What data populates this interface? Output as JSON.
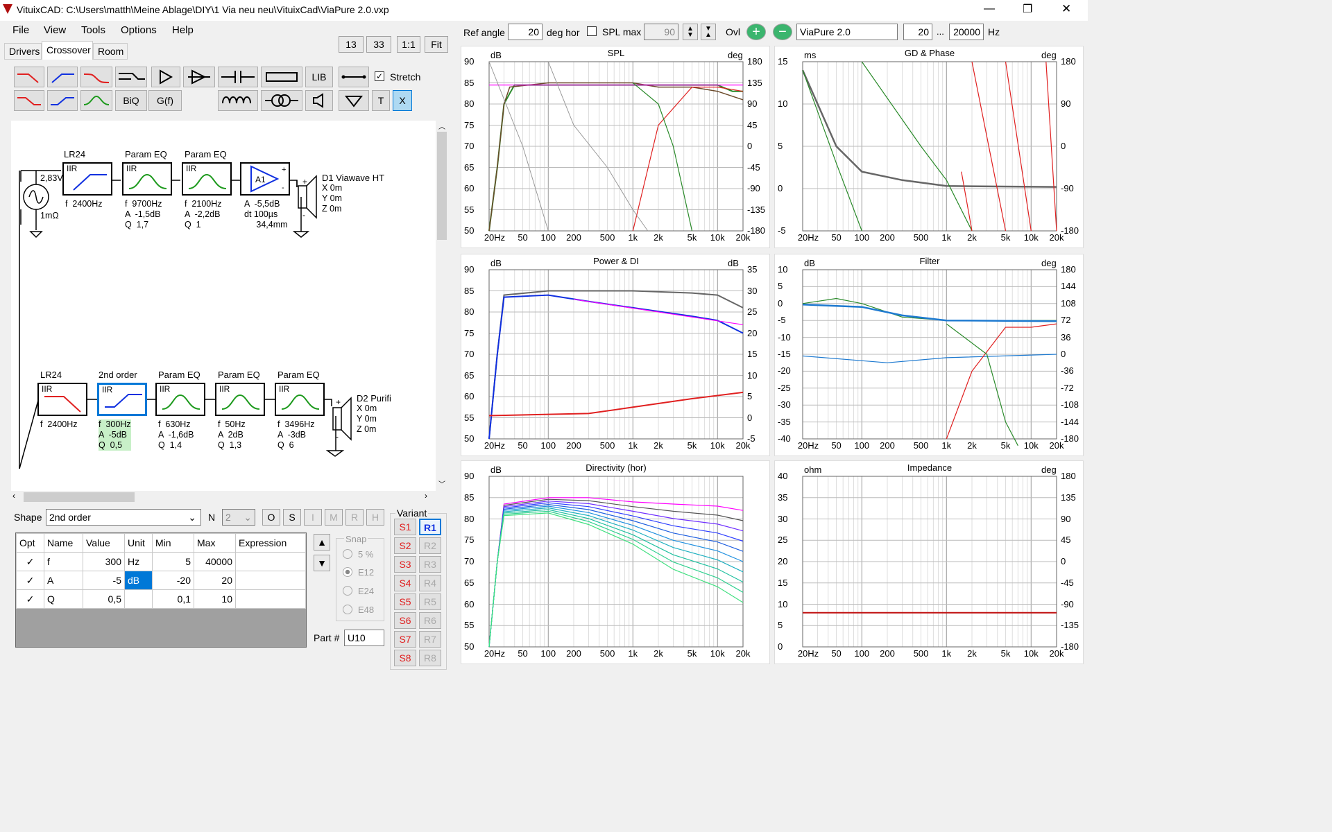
{
  "window": {
    "title": "VituixCAD: C:\\Users\\matth\\Meine Ablage\\DIY\\1 Via neu neu\\VituixCad\\ViaPure 2.0.vxp",
    "min": "—",
    "max": "❐",
    "close": "✕"
  },
  "menu": [
    "File",
    "View",
    "Tools",
    "Options",
    "Help"
  ],
  "tabs": [
    "Drivers",
    "Crossover",
    "Room"
  ],
  "zoom": [
    "13",
    "33",
    "1:1",
    "Fit"
  ],
  "toolbar": {
    "lib": "LIB",
    "stretch": "Stretch",
    "biq": "BiQ",
    "gf": "G(f)",
    "t": "T",
    "x": "X"
  },
  "top": {
    "ref_angle_label": "Ref angle",
    "ref_angle": "20",
    "deg_hor": "deg hor",
    "spl_max_label": "SPL max",
    "spl_max": "90",
    "ovl": "Ovl",
    "project": "ViaPure 2.0",
    "f_low": "20",
    "dots": "...",
    "f_high": "20000",
    "hz": "Hz"
  },
  "branch1": {
    "source": {
      "voltage": "2,83V",
      "impedance": "1mΩ"
    },
    "blocks": [
      {
        "title": "LR24",
        "type": "IIR",
        "params": "f  2400Hz"
      },
      {
        "title": "Param EQ",
        "type": "IIR",
        "params": "f  9700Hz\nA  -1,5dB\nQ  1,7"
      },
      {
        "title": "Param EQ",
        "type": "IIR",
        "params": "f  2100Hz\nA  -2,2dB\nQ  1"
      },
      {
        "title": "",
        "type": "A1",
        "params": "A  -5,5dB\ndt 100µs\n     34,4mm"
      }
    ],
    "driver": {
      "name": "D1 Viawave HT",
      "pos": "X 0m\nY 0m\nZ 0m"
    }
  },
  "branch2": {
    "blocks": [
      {
        "title": "LR24",
        "type": "IIR",
        "params": "f  2400Hz"
      },
      {
        "title": "2nd order",
        "type": "IIR",
        "params": "f  300Hz\nA  -5dB\nQ  0,5"
      },
      {
        "title": "Param EQ",
        "type": "IIR",
        "params": "f  630Hz\nA  -1,6dB\nQ  1,4"
      },
      {
        "title": "Param EQ",
        "type": "IIR",
        "params": "f  50Hz\nA  2dB\nQ  1,3"
      },
      {
        "title": "Param EQ",
        "type": "IIR",
        "params": "f  3496Hz\nA  -3dB\nQ  6"
      }
    ],
    "driver": {
      "name": "D2 Purifi",
      "pos": "X 0m\nY 0m\nZ 0m"
    }
  },
  "editor": {
    "shape_label": "Shape",
    "shape": "2nd order",
    "n_label": "N",
    "n": "2",
    "flags": [
      "O",
      "S",
      "I",
      "M",
      "R",
      "H"
    ],
    "headers": [
      "Opt",
      "Name",
      "Value",
      "Unit",
      "Min",
      "Max",
      "Expression"
    ],
    "rows": [
      {
        "opt": "✓",
        "name": "f",
        "value": "300",
        "unit": "Hz",
        "min": "5",
        "max": "40000",
        "expr": ""
      },
      {
        "opt": "✓",
        "name": "A",
        "value": "-5",
        "unit": "dB",
        "min": "-20",
        "max": "20",
        "expr": ""
      },
      {
        "opt": "✓",
        "name": "Q",
        "value": "0,5",
        "unit": "",
        "min": "0,1",
        "max": "10",
        "expr": ""
      }
    ],
    "snap_label": "Snap",
    "snap": [
      "5 %",
      "E12",
      "E24",
      "E48"
    ],
    "part_label": "Part #",
    "part": "U10",
    "variant_label": "Variant",
    "s": [
      "S1",
      "S2",
      "S3",
      "S4",
      "S5",
      "S6",
      "S7",
      "S8"
    ],
    "r": [
      "R1",
      "R2",
      "R3",
      "R4",
      "R5",
      "R6",
      "R7",
      "R8"
    ]
  },
  "xticks": [
    "20Hz",
    "50",
    "100",
    "200",
    "500",
    "1k",
    "2k",
    "5k",
    "10k",
    "20k"
  ],
  "graphs": [
    {
      "title": "SPL",
      "lu": "dB",
      "ru": "deg",
      "left": [
        "90",
        "85",
        "80",
        "75",
        "70",
        "65",
        "60",
        "55",
        "50"
      ],
      "right": [
        "180",
        "135",
        "90",
        "45",
        "0",
        "-45",
        "-90",
        "-135",
        "-180"
      ]
    },
    {
      "title": "GD & Phase",
      "lu": "ms",
      "ru": "deg",
      "left": [
        "15",
        "10",
        "5",
        "0",
        "-5"
      ],
      "right": [
        "180",
        "90",
        "0",
        "-90",
        "-180"
      ]
    },
    {
      "title": "Power & DI",
      "lu": "dB",
      "ru": "dB",
      "left": [
        "90",
        "85",
        "80",
        "75",
        "70",
        "65",
        "60",
        "55",
        "50"
      ],
      "right": [
        "35",
        "30",
        "25",
        "20",
        "15",
        "10",
        "5",
        "0",
        "-5"
      ]
    },
    {
      "title": "Filter",
      "lu": "dB",
      "ru": "deg",
      "left": [
        "10",
        "5",
        "0",
        "-5",
        "-10",
        "-15",
        "-20",
        "-25",
        "-30",
        "-35",
        "-40"
      ],
      "right": [
        "180",
        "144",
        "108",
        "72",
        "36",
        "0",
        "-36",
        "-72",
        "-108",
        "-144",
        "-180"
      ]
    },
    {
      "title": "Directivity (hor)",
      "lu": "dB",
      "ru": "",
      "left": [
        "90",
        "85",
        "80",
        "75",
        "70",
        "65",
        "60",
        "55",
        "50"
      ],
      "right": []
    },
    {
      "title": "Impedance",
      "lu": "ohm",
      "ru": "deg",
      "left": [
        "40",
        "35",
        "30",
        "25",
        "20",
        "15",
        "10",
        "5",
        "0"
      ],
      "right": [
        "180",
        "135",
        "90",
        "45",
        "0",
        "-45",
        "-90",
        "-135",
        "-180"
      ]
    }
  ],
  "colors": {
    "accent": "#0078d7",
    "red": "#e02020",
    "green": "#1e9a1e",
    "blue": "#1030e0"
  }
}
